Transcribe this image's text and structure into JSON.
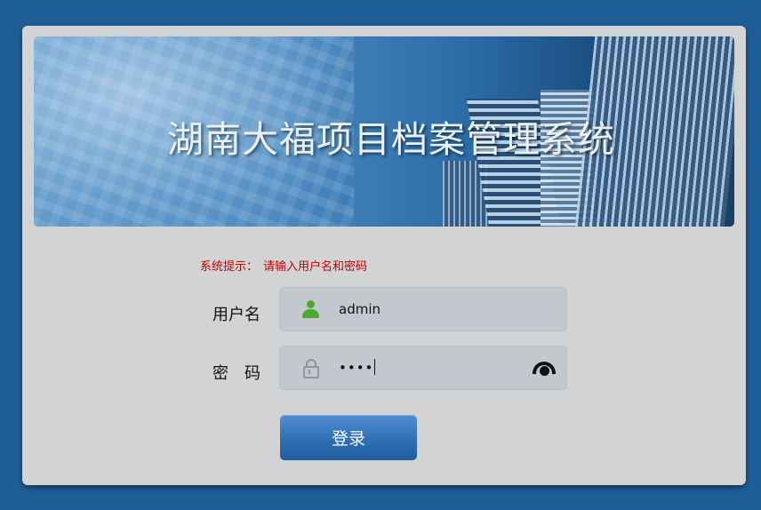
{
  "banner": {
    "title": "湖南大福项目档案管理系统"
  },
  "hint": {
    "label": "系统提示：",
    "message": "请输入用户名和密码"
  },
  "username": {
    "label": "用户名",
    "value": "admin",
    "icon": "user-icon"
  },
  "password": {
    "label": "密　码",
    "masked_value": "••••",
    "icon": "lock-icon",
    "toggle_icon": "eye-icon"
  },
  "login_button": {
    "label": "登录"
  },
  "colors": {
    "background": "#1f5d97",
    "card": "#d2d3d5",
    "hint": "#c40000",
    "user_icon": "#4ea72e",
    "button": "#2f6fb5"
  }
}
